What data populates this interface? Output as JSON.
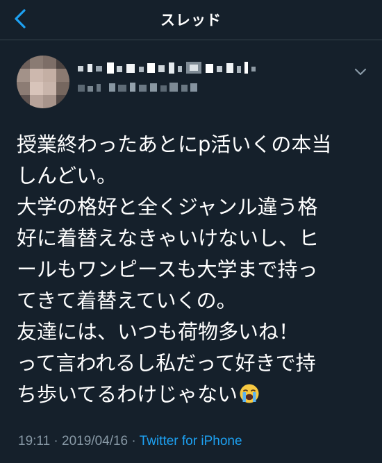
{
  "header": {
    "title": "スレッド",
    "back_icon": "chevron-left-icon"
  },
  "author": {
    "avatar_icon": "avatar-blurred",
    "display_name": "",
    "handle": "",
    "caret_icon": "chevron-down-icon"
  },
  "tweet": {
    "lines": [
      "授業終わったあとにp活いくの本当",
      "しんどい。",
      "大学の格好と全くジャンル違う格",
      "好に着替えなきゃいけないし、ヒ",
      "ールもワンピースも大学まで持っ",
      "てきて着替えていくの。",
      "友達には、いつも荷物多いね！",
      "って言われるし私だって好きで持",
      "ち歩いてるわけじゃない"
    ],
    "trailing_emoji": "loudly-crying-face-icon"
  },
  "meta": {
    "time": "19:11",
    "separator": " · ",
    "date": "2019/04/16",
    "source": "Twitter for iPhone"
  },
  "colors": {
    "background": "#15202b",
    "divider": "#38444d",
    "accent": "#1da1f2",
    "secondary_text": "#8899a6",
    "primary_text": "#ffffff"
  }
}
